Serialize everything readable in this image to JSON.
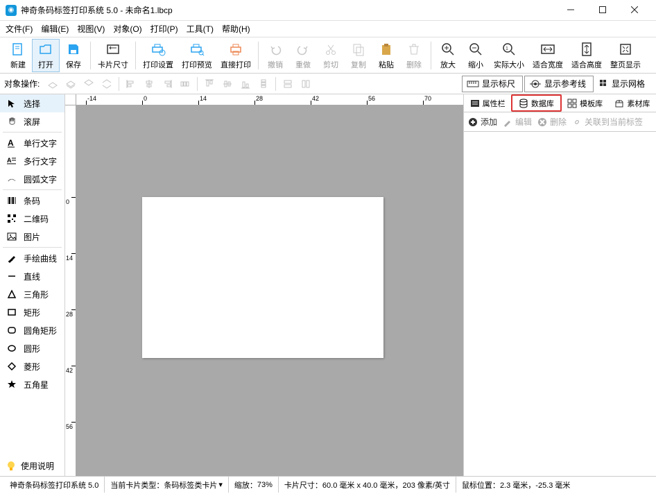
{
  "window": {
    "title": "神奇条码标签打印系统 5.0 - 未命名1.lbcp"
  },
  "menu": {
    "file": "文件(F)",
    "edit": "编辑(E)",
    "view": "视图(V)",
    "object": "对象(O)",
    "print": "打印(P)",
    "tool": "工具(T)",
    "help": "帮助(H)"
  },
  "toolbar": {
    "new": "新建",
    "open": "打开",
    "save": "保存",
    "card_size": "卡片尺寸",
    "print_settings": "打印设置",
    "print_preview": "打印预览",
    "direct_print": "直接打印",
    "undo": "撤销",
    "redo": "重做",
    "cut": "剪切",
    "copy": "复制",
    "paste": "粘贴",
    "delete": "删除",
    "zoom_in": "放大",
    "zoom_out": "缩小",
    "actual_size": "实际大小",
    "fit_width": "适合宽度",
    "fit_height": "适合高度",
    "fit_page": "整页显示"
  },
  "subtoolbar": {
    "object_ops": "对象操作:",
    "show_ruler": "显示标尺",
    "show_guides": "显示参考线",
    "show_grid": "显示网格"
  },
  "tools": {
    "select": "选择",
    "pan": "滚屏",
    "single_text": "单行文字",
    "multi_text": "多行文字",
    "arc_text": "圆弧文字",
    "barcode": "条码",
    "qrcode": "二维码",
    "image": "图片",
    "freehand": "手绘曲线",
    "line": "直线",
    "triangle": "三角形",
    "rect": "矩形",
    "roundrect": "圆角矩形",
    "ellipse": "圆形",
    "diamond": "菱形",
    "star": "五角星",
    "help_guide": "使用说明"
  },
  "ruler": {
    "h": [
      "-14",
      "0",
      "14",
      "28",
      "42",
      "56",
      "70"
    ],
    "v": [
      "0",
      "14",
      "28",
      "42",
      "56"
    ]
  },
  "right_panel": {
    "tabs": {
      "properties": "属性栏",
      "database": "数据库",
      "templates": "模板库",
      "assets": "素材库"
    },
    "actions": {
      "add": "添加",
      "edit": "编辑",
      "delete": "删除",
      "link": "关联到当前标签"
    }
  },
  "status": {
    "app": "神奇条码标签打印系统 5.0",
    "card_type_label": "当前卡片类型：",
    "card_type_value": "条码标签类卡片",
    "zoom_label": "缩放：",
    "zoom_value": "73%",
    "size_label": "卡片尺寸：",
    "size_value": "60.0 毫米 x 40.0 毫米，203 像素/英寸",
    "mouse_label": "鼠标位置：",
    "mouse_value": "2.3 毫米，-25.3 毫米"
  }
}
